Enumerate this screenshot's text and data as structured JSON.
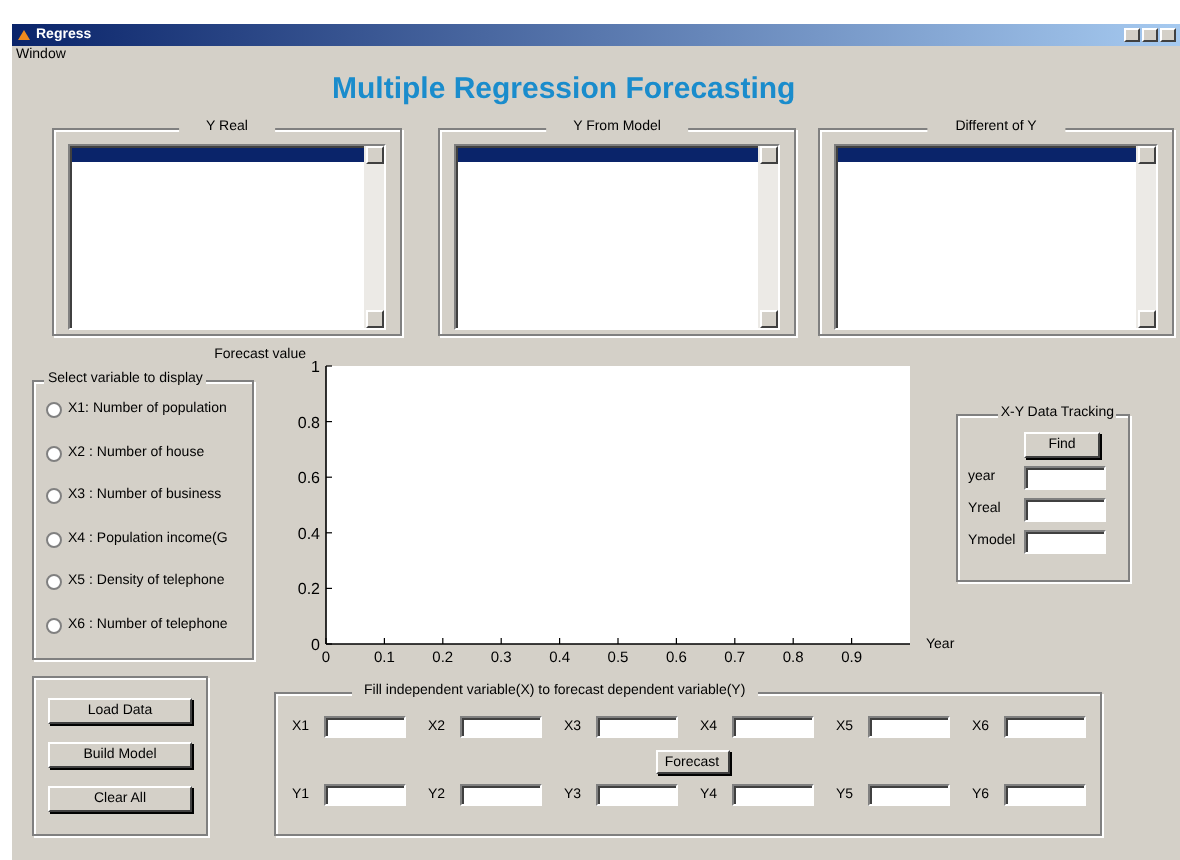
{
  "window": {
    "title": "Regress"
  },
  "menu": [
    "Window"
  ],
  "heading": "Multiple Regression Forecasting",
  "listboxes": [
    {
      "title": "Y Real",
      "row_highlighted": true
    },
    {
      "title": "Y From Model",
      "row_highlighted": true
    },
    {
      "title": "Different of Y",
      "row_highlighted": true
    }
  ],
  "variable_panel": {
    "title": "Select variable to display",
    "options": [
      {
        "label": "X1: Number of population",
        "selected": false
      },
      {
        "label": "X2 : Number of house",
        "selected": false
      },
      {
        "label": "X3 : Number of business",
        "selected": false
      },
      {
        "label": "X4 : Population income(G",
        "selected": false
      },
      {
        "label": "X5 : Density of telephone",
        "selected": false
      },
      {
        "label": "X6 : Number of telephone",
        "selected": false
      }
    ]
  },
  "chart_data": {
    "type": "line",
    "xlabel": "Year",
    "ylabel": "Forecast value",
    "xlim": [
      0,
      1
    ],
    "ylim": [
      0,
      1
    ],
    "xticks": [
      0,
      0.1,
      0.2,
      0.3,
      0.4,
      0.5,
      0.6,
      0.7,
      0.8,
      0.9
    ],
    "yticks": [
      0,
      0.2,
      0.4,
      0.6,
      0.8,
      1
    ]
  },
  "tracking": {
    "title": "X-Y Data Tracking",
    "button": "Find",
    "fields": [
      {
        "label": "year"
      },
      {
        "label": "Yreal"
      },
      {
        "label": "Ymodel"
      }
    ]
  },
  "actions": [
    "Load Data",
    "Build Model",
    "Clear All"
  ],
  "forecast_panel": {
    "title": "Fill independent variable(X) to forecast dependent variable(Y)",
    "x_fields": [
      {
        "label": "X1"
      },
      {
        "label": "X2"
      },
      {
        "label": "X3"
      },
      {
        "label": "X4"
      },
      {
        "label": "X5"
      },
      {
        "label": "X6"
      }
    ],
    "button": "Forecast",
    "y_fields": [
      {
        "label": "Y1"
      },
      {
        "label": "Y2"
      },
      {
        "label": "Y3"
      },
      {
        "label": "Y4"
      },
      {
        "label": "Y5"
      },
      {
        "label": "Y6"
      }
    ]
  }
}
